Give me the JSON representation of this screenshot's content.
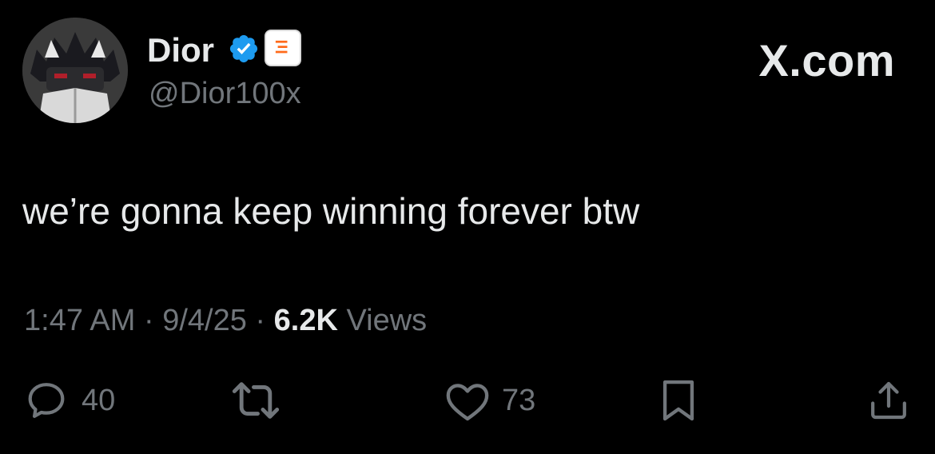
{
  "author": {
    "name": "Dior",
    "handle": "@Dior100x"
  },
  "brand": "X.com",
  "tweet": {
    "text": "we’re gonna keep winning forever btw"
  },
  "meta": {
    "time": "1:47 AM",
    "sep1": "·",
    "date": "9/4/25",
    "sep2": "·",
    "views_count": "6.2K",
    "views_label": "Views"
  },
  "actions": {
    "replies": "40",
    "likes": "73"
  },
  "colors": {
    "background": "#000000",
    "primary_text": "#e7e9ea",
    "secondary_text": "#71767b",
    "verified_blue": "#1d9bf0",
    "affiliate_orange": "#ff6a1a"
  },
  "icons": [
    "verified-badge-icon",
    "affiliate-badge-icon",
    "reply-icon",
    "repost-icon",
    "like-icon",
    "bookmark-icon",
    "share-icon"
  ]
}
